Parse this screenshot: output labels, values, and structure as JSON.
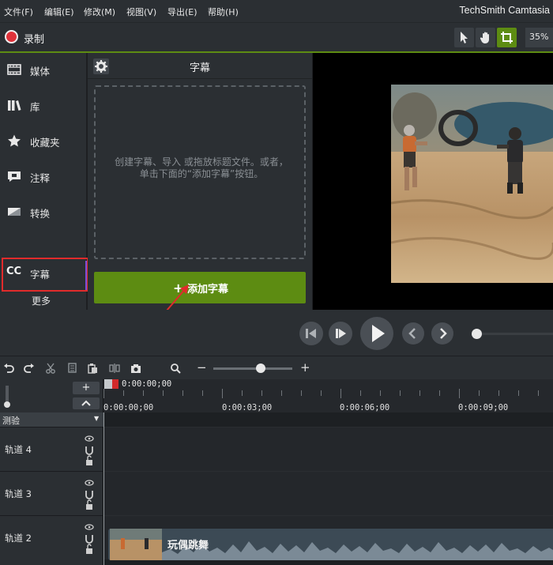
{
  "menu": {
    "items": [
      "文件(F)",
      "编辑(E)",
      "修改(M)",
      "视图(V)",
      "导出(E)",
      "帮助(H)"
    ],
    "app_title": "TechSmith Camtasia"
  },
  "record": {
    "label": "录制"
  },
  "toolbar": {
    "zoom": "35%"
  },
  "sidebar": {
    "items": [
      {
        "label": "媒体",
        "icon": "film-icon"
      },
      {
        "label": "库",
        "icon": "library-icon"
      },
      {
        "label": "收藏夹",
        "icon": "star-icon"
      },
      {
        "label": "注释",
        "icon": "annotation-icon"
      },
      {
        "label": "转换",
        "icon": "transition-icon"
      },
      {
        "label": "字幕",
        "icon": "cc-icon"
      }
    ],
    "cc_glyph": "CC",
    "more": "更多"
  },
  "panel": {
    "title": "字幕",
    "empty_text": "创建字幕、导入 或拖放标题文件。或者，单击下面的“添加字幕”按钮。",
    "add_button": "添加字幕"
  },
  "timeline": {
    "playhead_time": "0:00:00;00",
    "ruler_labels": [
      "0:00:00;00",
      "0:00:03;00",
      "0:00:06;00",
      "0:00:09;00"
    ],
    "marker_label": "测验",
    "tracks": [
      {
        "name": "轨道 4"
      },
      {
        "name": "轨道 3"
      },
      {
        "name": "轨道 2",
        "clip": "玩偶跳舞"
      }
    ],
    "zoom_level": 0.6
  },
  "colors": {
    "accent": "#5d8c12",
    "record": "#e0323a",
    "highlight_box": "#e12b2b"
  }
}
